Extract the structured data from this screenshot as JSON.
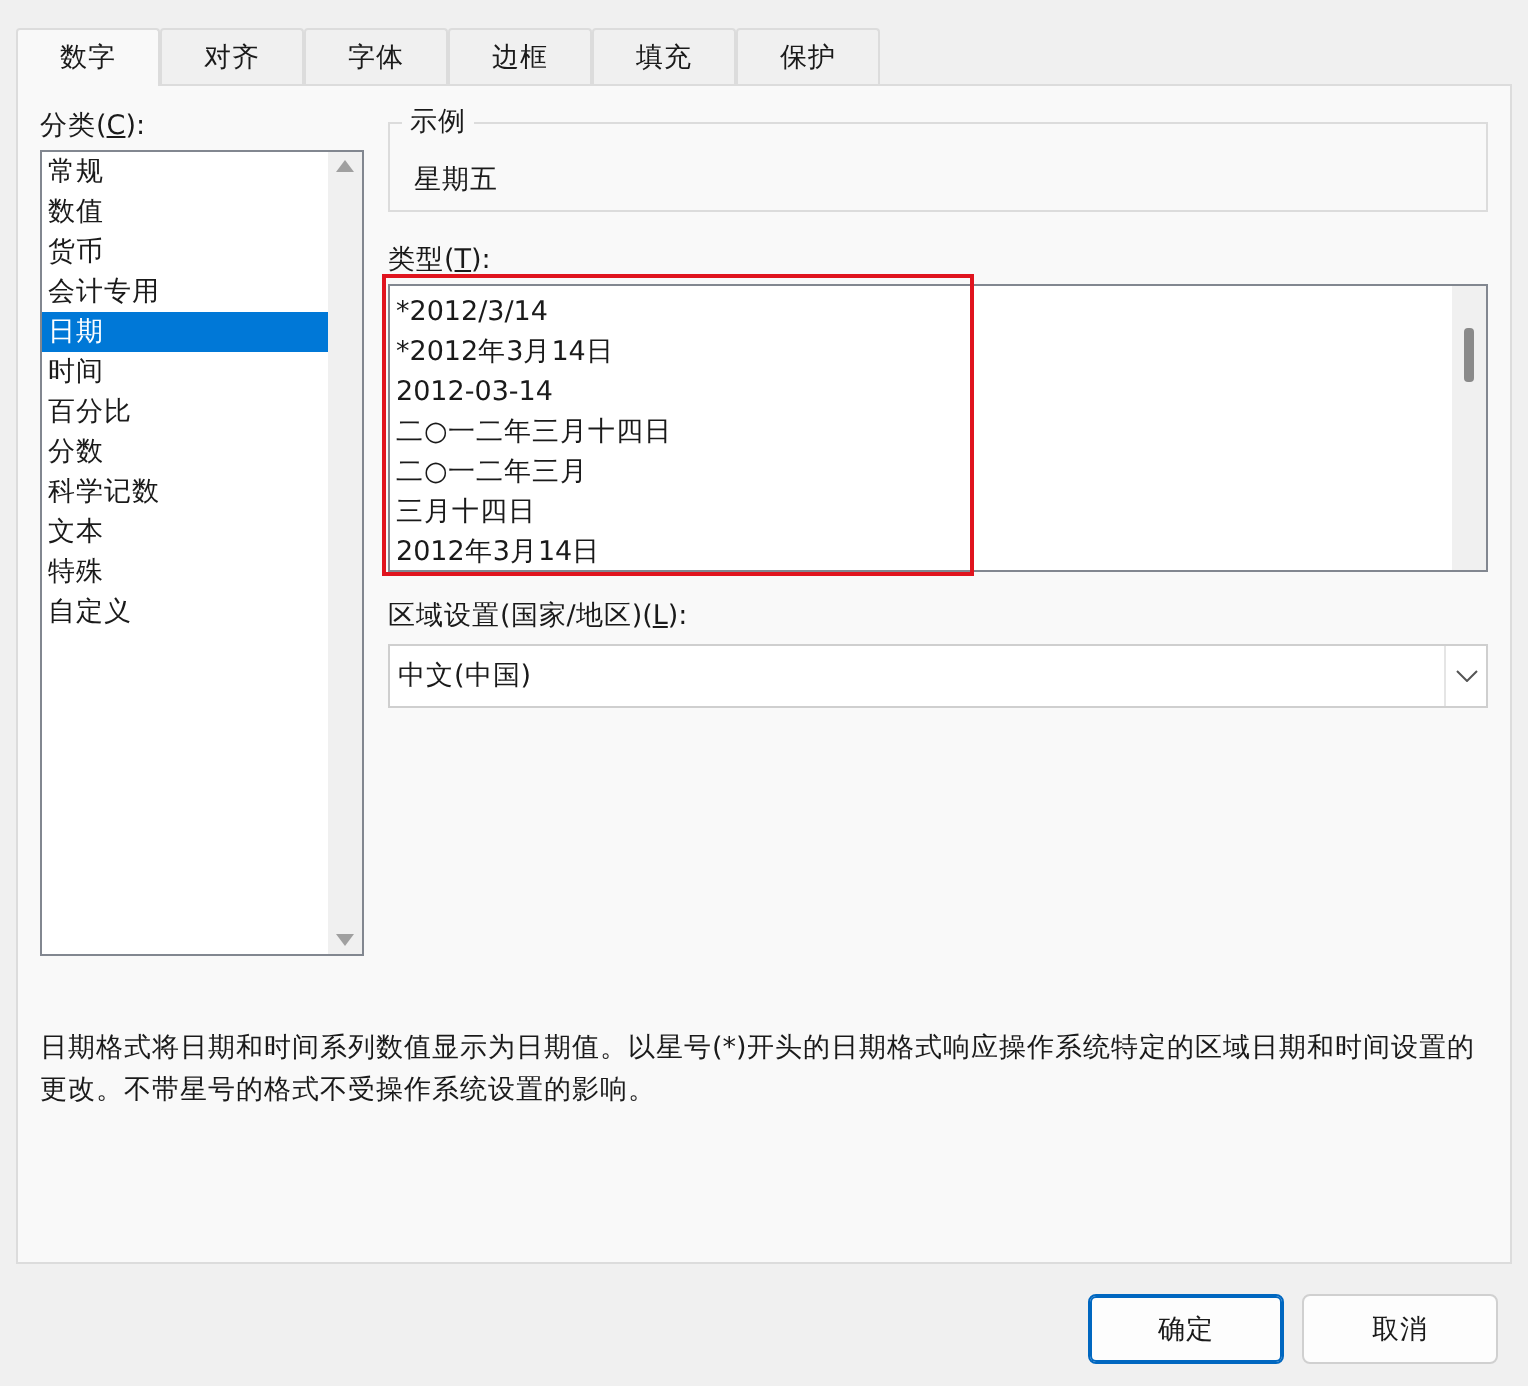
{
  "tabs": [
    {
      "label": "数字",
      "selected": true
    },
    {
      "label": "对齐",
      "selected": false
    },
    {
      "label": "字体",
      "selected": false
    },
    {
      "label": "边框",
      "selected": false
    },
    {
      "label": "填充",
      "selected": false
    },
    {
      "label": "保护",
      "selected": false
    }
  ],
  "category": {
    "label": {
      "before": "分类(",
      "key": "C",
      "after": "):"
    },
    "items": [
      {
        "label": "常规",
        "selected": false
      },
      {
        "label": "数值",
        "selected": false
      },
      {
        "label": "货币",
        "selected": false
      },
      {
        "label": "会计专用",
        "selected": false
      },
      {
        "label": "日期",
        "selected": true
      },
      {
        "label": "时间",
        "selected": false
      },
      {
        "label": "百分比",
        "selected": false
      },
      {
        "label": "分数",
        "selected": false
      },
      {
        "label": "科学记数",
        "selected": false
      },
      {
        "label": "文本",
        "selected": false
      },
      {
        "label": "特殊",
        "selected": false
      },
      {
        "label": "自定义",
        "selected": false
      }
    ]
  },
  "sample": {
    "title": "示例",
    "value": "星期五"
  },
  "type": {
    "label": {
      "before": "类型(",
      "key": "T",
      "after": "):"
    },
    "highlighted": true,
    "items": [
      {
        "label": "*2012/3/14"
      },
      {
        "label": "*2012年3月14日"
      },
      {
        "label": "2012-03-14"
      },
      {
        "label": "二○一二年三月十四日"
      },
      {
        "label": "二○一二年三月"
      },
      {
        "label": "三月十四日"
      },
      {
        "label": "2012年3月14日"
      }
    ]
  },
  "locale": {
    "label": {
      "before": "区域设置(国家/地区)(",
      "key": "L",
      "after": "):"
    },
    "value": "中文(中国)"
  },
  "description": "日期格式将日期和时间系列数值显示为日期值。以星号(*)开头的日期格式响应操作系统特定的区域日期和时间设置的更改。不带星号的格式不受操作系统设置的影响。",
  "buttons": [
    {
      "label": "确定",
      "default": true
    },
    {
      "label": "取消",
      "default": false
    }
  ]
}
